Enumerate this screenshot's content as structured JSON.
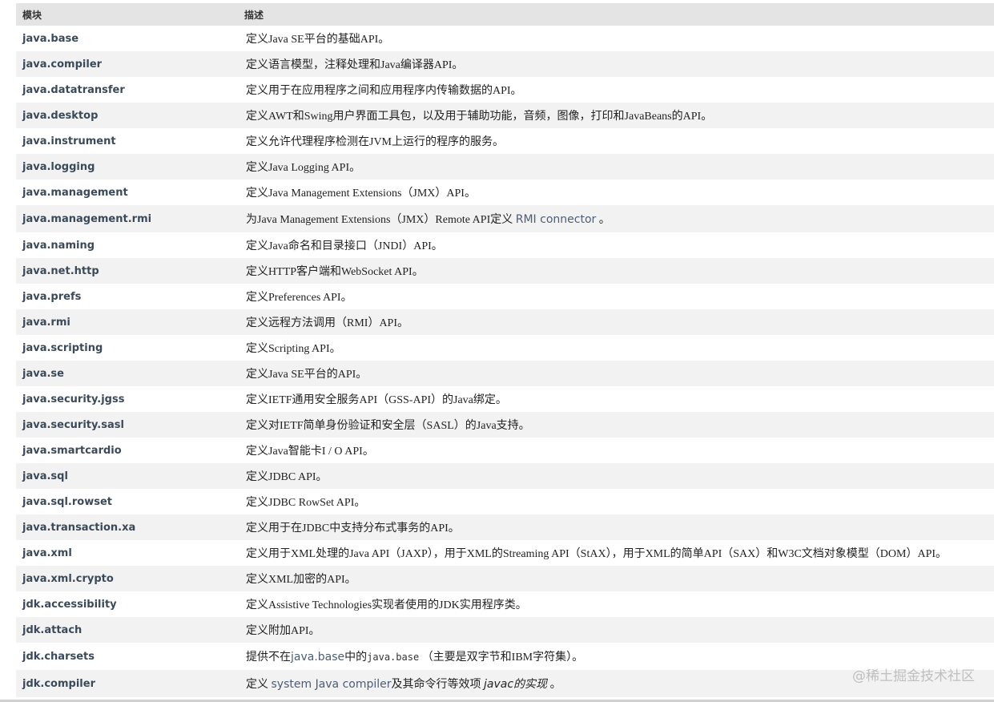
{
  "header": {
    "module": "模块",
    "description": "描述"
  },
  "rows": [
    {
      "module": "java.base",
      "desc": "定义Java SE平台的基础API。"
    },
    {
      "module": "java.compiler",
      "desc": "定义语言模型，注释处理和Java编译器API。"
    },
    {
      "module": "java.datatransfer",
      "desc": "定义用于在应用程序之间和应用程序内传输数据的API。"
    },
    {
      "module": "java.desktop",
      "desc": "定义AWT和Swing用户界面工具包，以及用于辅助功能，音频，图像，打印和JavaBeans的API。"
    },
    {
      "module": "java.instrument",
      "desc": "定义允许代理程序检测在JVM上运行的程序的服务。"
    },
    {
      "module": "java.logging",
      "desc": "定义Java Logging API。"
    },
    {
      "module": "java.management",
      "desc": "定义Java Management Extensions（JMX）API。"
    },
    {
      "module": "java.management.rmi",
      "desc_a": "为Java Management Extensions（JMX）Remote API定义 ",
      "desc_link": "RMI connector",
      "desc_b": " 。"
    },
    {
      "module": "java.naming",
      "desc": "定义Java命名和目录接口（JNDI）API。"
    },
    {
      "module": "java.net.http",
      "desc": "定义HTTP客户端和WebSocket API。"
    },
    {
      "module": "java.prefs",
      "desc": "定义Preferences API。"
    },
    {
      "module": "java.rmi",
      "desc": "定义远程方法调用（RMI）API。"
    },
    {
      "module": "java.scripting",
      "desc": "定义Scripting API。"
    },
    {
      "module": "java.se",
      "desc": "定义Java SE平台的API。"
    },
    {
      "module": "java.security.jgss",
      "desc": "定义IETF通用安全服务API（GSS-API）的Java绑定。"
    },
    {
      "module": "java.security.sasl",
      "desc": "定义对IETF简单身份验证和安全层（SASL）的Java支持。"
    },
    {
      "module": "java.smartcardio",
      "desc": "定义Java智能卡I / O API。"
    },
    {
      "module": "java.sql",
      "desc": "定义JDBC API。"
    },
    {
      "module": "java.sql.rowset",
      "desc": "定义JDBC RowSet API。"
    },
    {
      "module": "java.transaction.xa",
      "desc": "定义用于在JDBC中支持分布式事务的API。"
    },
    {
      "module": "java.xml",
      "desc": "定义用于XML处理的Java API（JAXP），用于XML的Streaming API（StAX），用于XML的简单API（SAX）和W3C文档对象模型（DOM）API。"
    },
    {
      "module": "java.xml.crypto",
      "desc": "定义XML加密的API。"
    },
    {
      "module": "jdk.accessibility",
      "desc": "定义Assistive Technologies实现者使用的JDK实用程序类。"
    },
    {
      "module": "jdk.attach",
      "desc": "定义附加API。"
    },
    {
      "module": "jdk.charsets",
      "desc_a": "提供不在",
      "desc_link": "java.base",
      "desc_mid": "中的",
      "desc_mono": "java.base",
      "desc_b": " （主要是双字节和IBM字符集）。"
    },
    {
      "module": "jdk.compiler",
      "desc_a": "定义 ",
      "desc_link": "system Java compiler",
      "desc_mid": "及其命令行等效项 ",
      "desc_ital": "javac的实现",
      "desc_b": " 。"
    }
  ],
  "watermark": "@稀土掘金技术社区"
}
